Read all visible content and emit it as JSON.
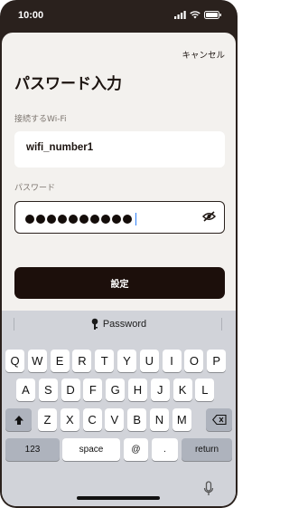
{
  "status": {
    "time": "10:00"
  },
  "header": {
    "cancel_label": "キャンセル",
    "title": "パスワード入力"
  },
  "form": {
    "wifi_label": "接続するWi-Fi",
    "wifi_value": "wifi_number1",
    "password_label": "パスワード",
    "password_masked_count": 10,
    "submit_label": "設定"
  },
  "keyboard": {
    "bar_label": "Password",
    "row1": [
      "Q",
      "W",
      "E",
      "R",
      "T",
      "Y",
      "U",
      "I",
      "O",
      "P"
    ],
    "row2": [
      "A",
      "S",
      "D",
      "F",
      "G",
      "H",
      "J",
      "K",
      "L"
    ],
    "row3": [
      "Z",
      "X",
      "C",
      "V",
      "B",
      "N",
      "M"
    ],
    "numbers_label": "123",
    "space_label": "space",
    "at_label": "@",
    "dot_label": ".",
    "return_label": "return"
  }
}
